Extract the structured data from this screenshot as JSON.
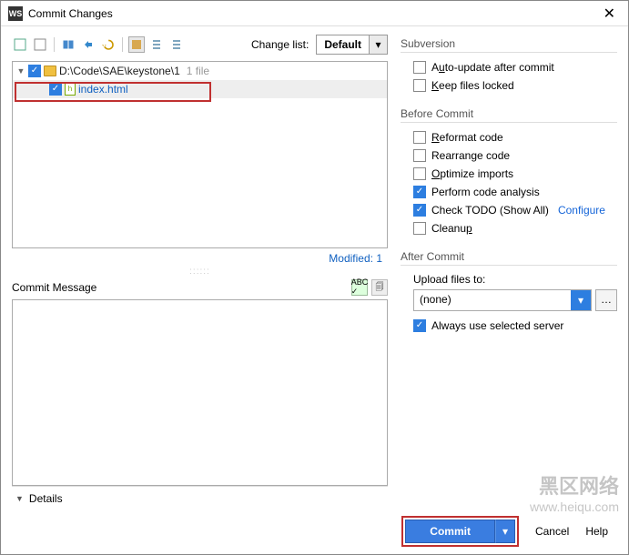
{
  "window": {
    "title": "Commit Changes"
  },
  "toolbar": {
    "change_list_label": "Change list:",
    "change_list_value": "Default"
  },
  "tree": {
    "root_path": "D:\\Code\\SAE\\keystone\\1",
    "root_hint": "1 file",
    "file_name": "index.html",
    "modified_label": "Modified: 1"
  },
  "commit_message": {
    "label": "Commit Message"
  },
  "details": {
    "label": "Details"
  },
  "subversion": {
    "title": "Subversion",
    "auto_update": {
      "label_pre": "A",
      "label_ul": "u",
      "label_post": "to-update after commit",
      "checked": false
    },
    "keep_locked": {
      "label_ul": "K",
      "label_post": "eep files locked",
      "checked": false
    }
  },
  "before": {
    "title": "Before Commit",
    "reformat": {
      "label_ul": "R",
      "label_post": "eformat code",
      "checked": false
    },
    "rearrange": {
      "label": "Rearrange code",
      "checked": false
    },
    "optimize": {
      "label_ul": "O",
      "label_post": "ptimize imports",
      "checked": false
    },
    "analysis": {
      "label": "Perform code analysis",
      "checked": true
    },
    "todo": {
      "label": "Check TODO (Show All)",
      "checked": true,
      "configure": "Configure"
    },
    "cleanup": {
      "label": "Cleanu",
      "label_ul": "p",
      "checked": false
    }
  },
  "after": {
    "title": "After Commit",
    "upload_label": "Upload files to:",
    "upload_value": "(none)",
    "always_use": {
      "label": "Always use selected server",
      "checked": true
    }
  },
  "footer": {
    "commit": "Commit",
    "cancel": "Cancel",
    "help": "Help"
  },
  "watermark": {
    "cn": "黑区网络",
    "url": "www.heiqu.com"
  }
}
